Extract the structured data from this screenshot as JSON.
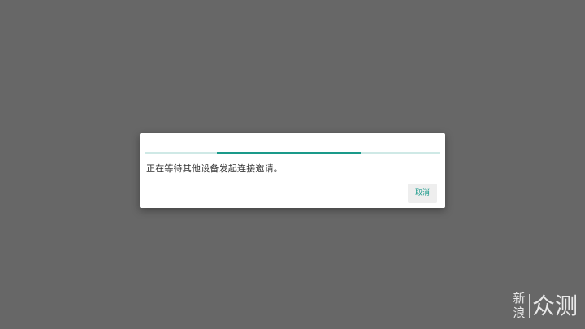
{
  "dialog": {
    "progress_fraction_start": 0.245,
    "progress_fraction_end": 0.73,
    "message": "正在等待其他设备发起连接邀请。",
    "cancel_label": "取消"
  },
  "watermark": {
    "line1": "新",
    "line2": "浪",
    "brand": "众测"
  },
  "colors": {
    "overlay": "#676767",
    "accent": "#1a9a8a",
    "track": "#cfe9e6"
  }
}
